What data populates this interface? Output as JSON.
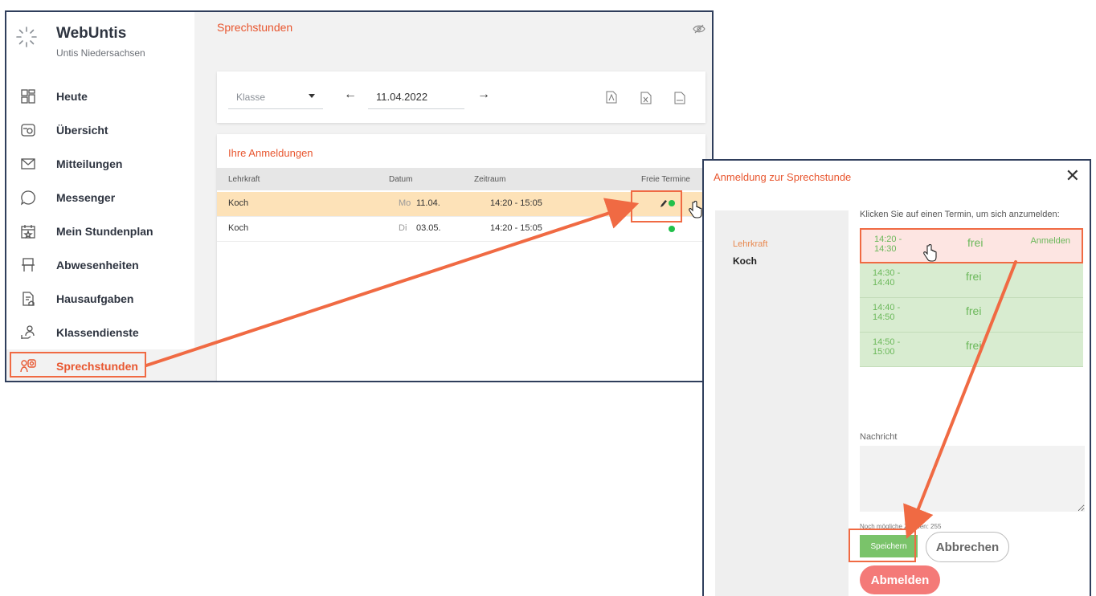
{
  "app": {
    "name": "WebUntis",
    "school": "Untis Niedersachsen"
  },
  "sidebar": {
    "items": [
      {
        "label": "Heute",
        "icon": "dashboard-icon"
      },
      {
        "label": "Übersicht",
        "icon": "overview-icon"
      },
      {
        "label": "Mitteilungen",
        "icon": "mail-icon"
      },
      {
        "label": "Messenger",
        "icon": "chat-icon"
      },
      {
        "label": "Mein Stundenplan",
        "icon": "calendar-icon"
      },
      {
        "label": "Abwesenheiten",
        "icon": "absence-icon"
      },
      {
        "label": "Hausaufgaben",
        "icon": "homework-icon"
      },
      {
        "label": "Klassendienste",
        "icon": "class-duty-icon"
      },
      {
        "label": "Sprechstunden",
        "icon": "office-hours-icon",
        "active": true
      }
    ]
  },
  "main": {
    "title": "Sprechstunden",
    "toolbar": {
      "select_value": "Klasse",
      "date": "11.04.2022"
    },
    "list": {
      "title": "Ihre Anmeldungen",
      "columns": [
        "Lehrkraft",
        "Datum",
        "Zeitraum",
        "Freie Termine"
      ],
      "rows": [
        {
          "teacher": "Koch",
          "weekday": "Mo",
          "date": "11.04.",
          "time": "14:20 - 15:05",
          "selected": true
        },
        {
          "teacher": "Koch",
          "weekday": "Di",
          "date": "03.05.",
          "time": "14:20 - 15:05",
          "selected": false
        }
      ]
    }
  },
  "dialog": {
    "title": "Anmeldung zur Sprechstunde",
    "close": "✕",
    "teacher_label": "Lehrkraft",
    "teacher_name": "Koch",
    "hint": "Klicken Sie auf einen Termin, um sich anzumelden:",
    "slots": [
      {
        "time": "14:20 - 14:30",
        "status": "frei",
        "action": "Anmelden"
      },
      {
        "time": "14:30 - 14:40",
        "status": "frei",
        "action": ""
      },
      {
        "time": "14:40 - 14:50",
        "status": "frei",
        "action": ""
      },
      {
        "time": "14:50 - 15:00",
        "status": "frei",
        "action": ""
      }
    ],
    "message_label": "Nachricht",
    "chars_left": "Noch mögliche Zeichen: 255",
    "save": "Speichern",
    "cancel": "Abbrechen",
    "logout": "Abmelden"
  },
  "colors": {
    "accent": "#e8562f",
    "highlight": "#f06a43",
    "success": "#21c04a",
    "slot_bg": "#d8ecd0"
  }
}
